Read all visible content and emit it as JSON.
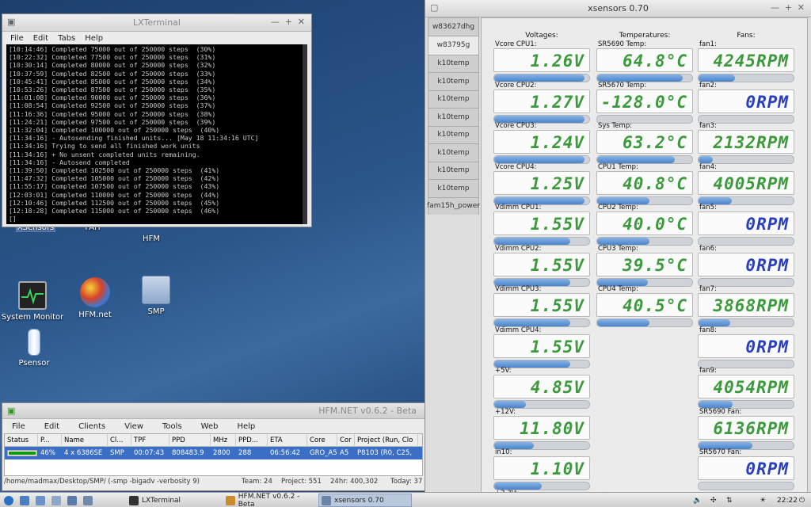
{
  "desktop": {
    "icons": [
      {
        "label": "XSensors"
      },
      {
        "label": "FAH"
      },
      {
        "label": "HFM"
      },
      {
        "label": "System Monitor"
      },
      {
        "label": "HFM.net"
      },
      {
        "label": "SMP"
      },
      {
        "label": "Psensor"
      }
    ]
  },
  "lxterminal": {
    "title": "LXTerminal",
    "menu": [
      "File",
      "Edit",
      "Tabs",
      "Help"
    ],
    "lines": [
      "[10:14:46] Completed 75000 out of 250000 steps  (30%)",
      "[10:22:32] Completed 77500 out of 250000 steps  (31%)",
      "[10:30:14] Completed 80000 out of 250000 steps  (32%)",
      "[10:37:59] Completed 82500 out of 250000 steps  (33%)",
      "[10:45:41] Completed 85000 out of 250000 steps  (34%)",
      "[10:53:26] Completed 87500 out of 250000 steps  (35%)",
      "[11:01:08] Completed 90000 out of 250000 steps  (36%)",
      "[11:08:54] Completed 92500 out of 250000 steps  (37%)",
      "[11:16:36] Completed 95000 out of 250000 steps  (38%)",
      "[11:24:21] Completed 97500 out of 250000 steps  (39%)",
      "[11:32:04] Completed 100000 out of 250000 steps  (40%)",
      "[11:34:16] - Autosending finished units... [May 18 11:34:16 UTC]",
      "[11:34:16] Trying to send all finished work units",
      "[11:34:16] + No unsent completed units remaining.",
      "[11:34:16] - Autosend completed",
      "[11:39:50] Completed 102500 out of 250000 steps  (41%)",
      "[11:47:32] Completed 105000 out of 250000 steps  (42%)",
      "[11:55:17] Completed 107500 out of 250000 steps  (43%)",
      "[12:03:01] Completed 110000 out of 250000 steps  (44%)",
      "[12:10:46] Completed 112500 out of 250000 steps  (45%)",
      "[12:18:28] Completed 115000 out of 250000 steps  (46%)",
      "[]"
    ]
  },
  "xsensors": {
    "title": "xsensors 0.70",
    "tabs": [
      "w83627dhg",
      "w83795g",
      "k10temp",
      "k10temp",
      "k10temp",
      "k10temp",
      "k10temp",
      "k10temp",
      "k10temp",
      "k10temp",
      "fam15h_power"
    ],
    "headers": {
      "voltages": "Voltages:",
      "temperatures": "Temperatures:",
      "fans": "Fans:"
    },
    "voltages": [
      {
        "label": "Vcore CPU1:",
        "value": "1.26V",
        "level": 0.95
      },
      {
        "label": "Vcore CPU2:",
        "value": "1.27V",
        "level": 0.95
      },
      {
        "label": "Vcore CPU3:",
        "value": "1.24V",
        "level": 0.95
      },
      {
        "label": "Vcore CPU4:",
        "value": "1.25V",
        "level": 0.95
      },
      {
        "label": "Vdimm CPU1:",
        "value": "1.55V",
        "level": 0.8
      },
      {
        "label": "Vdimm CPU2:",
        "value": "1.55V",
        "level": 0.8
      },
      {
        "label": "Vdimm CPU3:",
        "value": "1.55V",
        "level": 0.8
      },
      {
        "label": "Vdimm CPU4:",
        "value": "1.55V",
        "level": 0.8
      },
      {
        "label": "+5V:",
        "value": "4.85V",
        "level": 0.33
      },
      {
        "label": "+12V:",
        "value": "11.80V",
        "level": 0.42
      },
      {
        "label": "in10:",
        "value": "1.10V",
        "level": 0.5
      },
      {
        "label": "+3.3V:",
        "value": "",
        "level": 0
      }
    ],
    "temperatures": [
      {
        "label": "SR5690 Temp:",
        "value": "64.8°C",
        "level": 0.9
      },
      {
        "label": "SR5670 Temp:",
        "value": "-128.0°C",
        "level": 0.0
      },
      {
        "label": "Sys Temp:",
        "value": "63.2°C",
        "level": 0.82
      },
      {
        "label": "CPU1 Temp:",
        "value": "40.8°C",
        "level": 0.55
      },
      {
        "label": "CPU2 Temp:",
        "value": "40.0°C",
        "level": 0.55
      },
      {
        "label": "CPU3 Temp:",
        "value": "39.5°C",
        "level": 0.53
      },
      {
        "label": "CPU4 Temp:",
        "value": "40.5°C",
        "level": 0.55
      }
    ],
    "fans": [
      {
        "label": "fan1:",
        "value": "4245RPM",
        "level": 0.38
      },
      {
        "label": "fan2:",
        "value": "0RPM",
        "level": 0
      },
      {
        "label": "fan3:",
        "value": "2132RPM",
        "level": 0.15
      },
      {
        "label": "fan4:",
        "value": "4005RPM",
        "level": 0.35
      },
      {
        "label": "fan5:",
        "value": "0RPM",
        "level": 0
      },
      {
        "label": "fan6:",
        "value": "0RPM",
        "level": 0
      },
      {
        "label": "fan7:",
        "value": "3868RPM",
        "level": 0.33
      },
      {
        "label": "fan8:",
        "value": "0RPM",
        "level": 0
      },
      {
        "label": "fan9:",
        "value": "4054RPM",
        "level": 0.36
      },
      {
        "label": "SR5690 Fan:",
        "value": "6136RPM",
        "level": 0.57
      },
      {
        "label": "SR5670 Fan:",
        "value": "0RPM",
        "level": 0
      }
    ]
  },
  "hfm": {
    "title": "HFM.NET v0.6.2 - Beta",
    "menu": [
      "File",
      "Edit",
      "Clients",
      "View",
      "Tools",
      "Web",
      "Help"
    ],
    "columns": [
      "Status",
      "P...",
      "Name",
      "Cl...",
      "TPF",
      "PPD",
      "MHz",
      "PPD...",
      "ETA",
      "Core",
      "Cor",
      "Project (Run, Clo"
    ],
    "row": {
      "progress": 0.46,
      "cells": [
        "",
        "46%",
        "4 x 6386SE",
        "SMP",
        "00:07:43",
        "808483.9",
        "2800",
        "288",
        "06:56:42",
        "GRO_A5",
        "A5",
        "P8103 (R0, C25,"
      ]
    },
    "status": {
      "path": "/home/madmax/Desktop/SMP/ (-smp -bigadv -verbosity 9)",
      "team": "Team: 24",
      "project": "Project: 551",
      "h24": "24hr: 400,302",
      "today": "Today: 37"
    }
  },
  "taskbar": {
    "tasks": [
      {
        "label": "LXTerminal",
        "active": false
      },
      {
        "label": "HFM.NET v0.6.2 - Beta",
        "active": false
      },
      {
        "label": "xsensors 0.70",
        "active": true
      }
    ],
    "clock": "22:22"
  }
}
